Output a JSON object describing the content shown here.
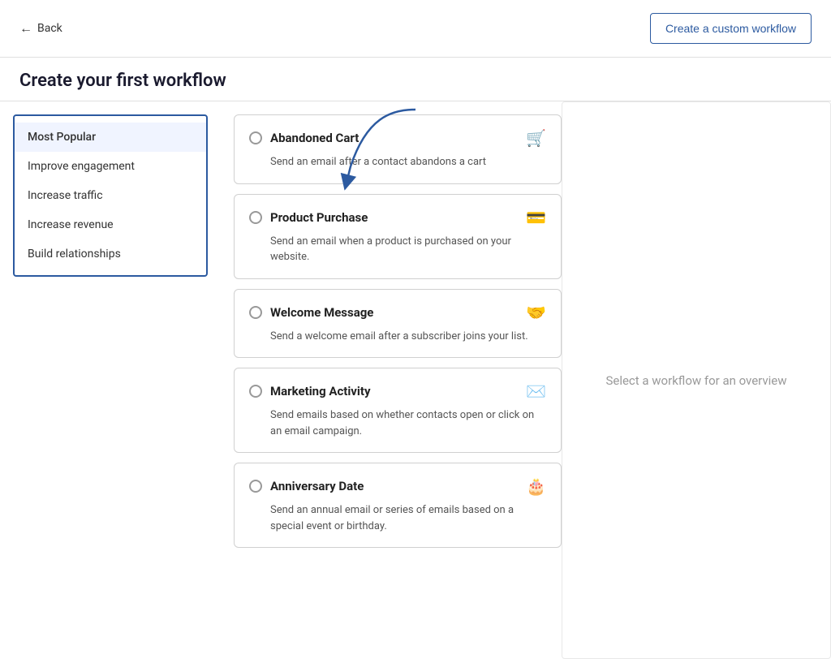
{
  "back": {
    "label": "Back"
  },
  "header": {
    "title": "Create your first workflow"
  },
  "createCustomButton": {
    "label": "Create a custom workflow"
  },
  "sidebar": {
    "items": [
      {
        "id": "most-popular",
        "label": "Most Popular",
        "active": true
      },
      {
        "id": "improve-engagement",
        "label": "Improve engagement",
        "active": false
      },
      {
        "id": "increase-traffic",
        "label": "Increase traffic",
        "active": false
      },
      {
        "id": "increase-revenue",
        "label": "Increase revenue",
        "active": false
      },
      {
        "id": "build-relationships",
        "label": "Build relationships",
        "active": false
      }
    ]
  },
  "workflows": [
    {
      "id": "abandoned-cart",
      "title": "Abandoned Cart",
      "description": "Send an email after a contact abandons a cart",
      "icon": "🛒"
    },
    {
      "id": "product-purchase",
      "title": "Product Purchase",
      "description": "Send an email when a product is purchased on your website.",
      "icon": "💳"
    },
    {
      "id": "welcome-message",
      "title": "Welcome Message",
      "description": "Send a welcome email after a subscriber joins your list.",
      "icon": "🤝"
    },
    {
      "id": "marketing-activity",
      "title": "Marketing Activity",
      "description": "Send emails based on whether contacts open or click on an email campaign.",
      "icon": "✉️"
    },
    {
      "id": "anniversary-date",
      "title": "Anniversary Date",
      "description": "Send an annual email or series of emails based on a special event or birthday.",
      "icon": "🎂"
    }
  ],
  "overview": {
    "placeholder": "Select a workflow for an overview"
  }
}
